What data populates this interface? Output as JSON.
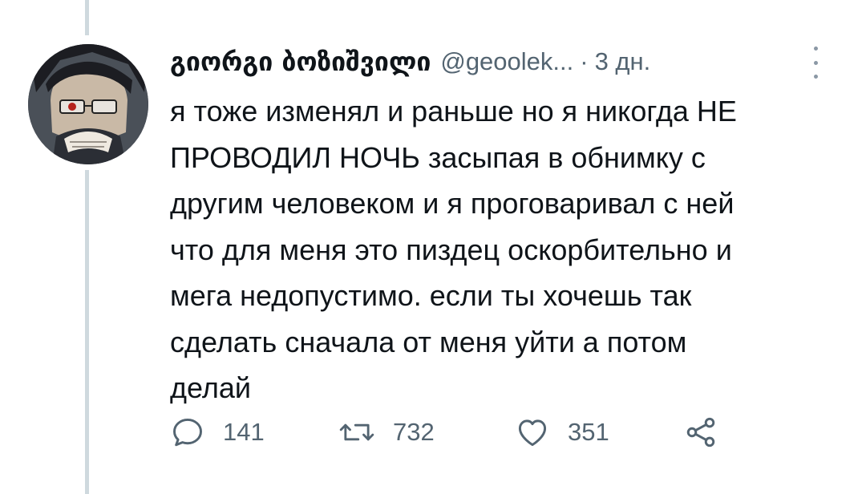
{
  "tweet": {
    "display_name": "გიორგი ბოზიშვილი",
    "handle": "@geoolek...",
    "separator": "·",
    "time": "3 дн.",
    "lines": [
      "я тоже изменял и раньше но я никогда НЕ",
      "ПРОВОДИЛ НОЧЬ засыпая в обнимку с",
      "другим человеком и я проговаривал с ней",
      "что для меня это пиздец оскорбительно и",
      "мега недопустимо. если ты хочешь так",
      "сделать сначала от меня уйти а потом",
      "делай"
    ]
  },
  "actions": {
    "replies": "141",
    "retweets": "732",
    "likes": "351"
  },
  "icons": {
    "reply": "reply-icon",
    "retweet": "retweet-icon",
    "like": "like-icon",
    "share": "share-icon",
    "more": "more-icon"
  },
  "colors": {
    "text": "#0f1419",
    "muted": "#536471",
    "thread_line": "#cfd9de"
  }
}
